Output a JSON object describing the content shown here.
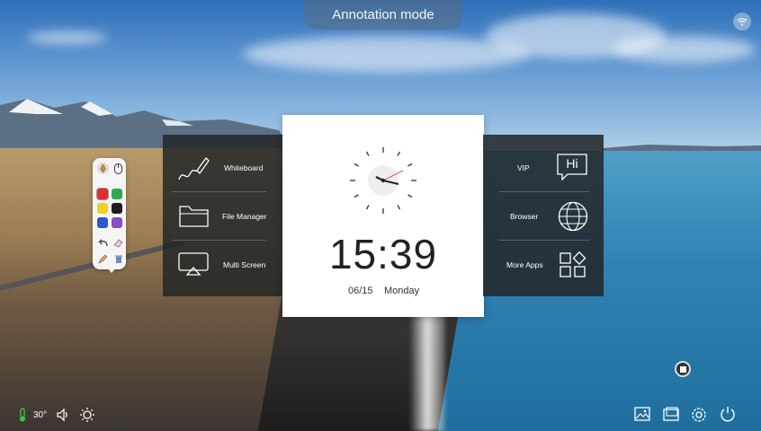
{
  "banner": {
    "title": "Annotation mode"
  },
  "launcher_left": [
    {
      "label": "Whiteboard",
      "icon": "pen-icon"
    },
    {
      "label": "File Manager",
      "icon": "folder-icon"
    },
    {
      "label": "Multi Screen",
      "icon": "screen-share-icon"
    }
  ],
  "launcher_right": [
    {
      "label": "VIP",
      "icon": "chat-hi-icon",
      "icon_text": "Hi"
    },
    {
      "label": "Browser",
      "icon": "globe-icon"
    },
    {
      "label": "More Apps",
      "icon": "apps-grid-icon"
    }
  ],
  "clock": {
    "time": "15:39",
    "date": "06/15",
    "weekday": "Monday"
  },
  "toolbar": {
    "colors": [
      "#e8292e",
      "#2dab4f",
      "#f0d21e",
      "#1c1c1c",
      "#2a58c8",
      "#8a4bc6"
    ]
  },
  "status": {
    "temperature": "30°"
  },
  "colors": {
    "panel": "#26292b",
    "banner": "#5a6e82",
    "card": "#ffffff"
  }
}
